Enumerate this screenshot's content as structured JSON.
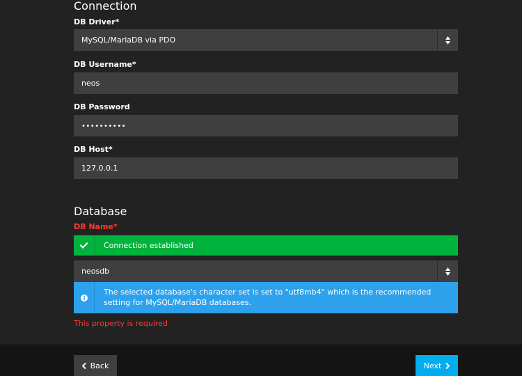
{
  "connection": {
    "title": "Connection",
    "db_driver": {
      "label": "DB Driver*",
      "value": "MySQL/MariaDB via PDO"
    },
    "db_username": {
      "label": "DB Username*",
      "value": "neos"
    },
    "db_password": {
      "label": "DB Password",
      "value": "••••••••••"
    },
    "db_host": {
      "label": "DB Host*",
      "value": "127.0.0.1"
    }
  },
  "database": {
    "title": "Database",
    "db_name": {
      "label": "DB Name*",
      "value": "neosdb"
    },
    "success_message": "Connection established",
    "info_message": "The selected database's character set is set to \"utf8mb4\" which is the recommended setting for MySQL/MariaDB databases.",
    "error_message": "This property is required"
  },
  "footer": {
    "back_label": "Back",
    "next_label": "Next"
  },
  "icons": {
    "select_arrow": "sort-arrows-icon",
    "success": "check-icon",
    "info": "info-circle-icon",
    "back": "chevron-left-icon",
    "next": "chevron-right-icon"
  },
  "colors": {
    "background": "#222222",
    "input": "#3f3f3f",
    "success": "#00b33c",
    "info": "#2ea1ec",
    "error": "#ff3a2e",
    "primary_button": "#00adee",
    "footer": "#141414"
  }
}
